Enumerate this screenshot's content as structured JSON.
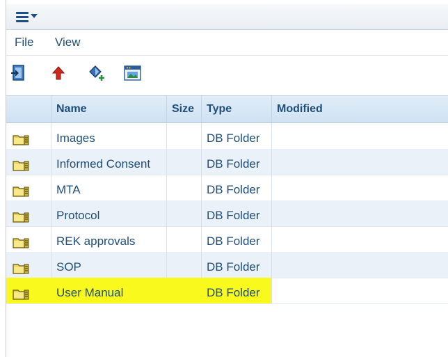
{
  "menu": {
    "file": "File",
    "view": "View"
  },
  "toolbar": {
    "tools": [
      {
        "icon": "exit-door-icon"
      },
      {
        "icon": "up-arrow-icon"
      },
      {
        "icon": "add-item-icon"
      },
      {
        "icon": "window-image-icon"
      }
    ]
  },
  "table": {
    "columns": [
      "Name",
      "Size",
      "Type",
      "Modified"
    ],
    "rows": [
      {
        "name": "Images",
        "size": "",
        "type": "DB Folder",
        "modified": ""
      },
      {
        "name": "Informed Consent",
        "size": "",
        "type": "DB Folder",
        "modified": ""
      },
      {
        "name": "MTA",
        "size": "",
        "type": "DB Folder",
        "modified": ""
      },
      {
        "name": "Protocol",
        "size": "",
        "type": "DB Folder",
        "modified": ""
      },
      {
        "name": "REK approvals",
        "size": "",
        "type": "DB Folder",
        "modified": ""
      },
      {
        "name": "SOP",
        "size": "",
        "type": "DB Folder",
        "modified": ""
      },
      {
        "name": "User Manual",
        "size": "",
        "type": "DB Folder",
        "modified": ""
      }
    ]
  },
  "colors": {
    "text": "#1f4e79",
    "header": "#cfe2f3",
    "alt_row": "#eaf1f8",
    "highlight": "#f9f91e"
  }
}
